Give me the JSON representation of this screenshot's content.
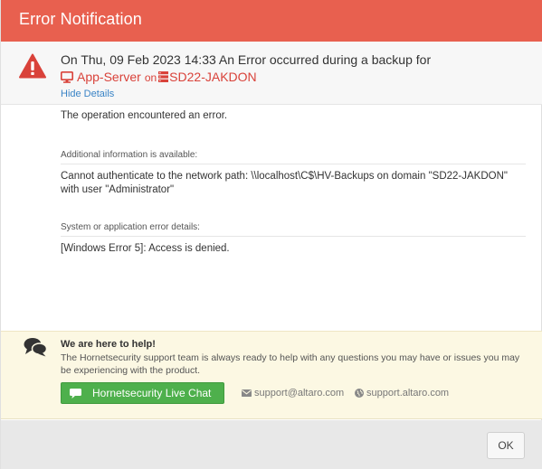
{
  "window": {
    "title": "Error Notification"
  },
  "summary": {
    "headline": "On Thu, 09 Feb 2023 14:33 An Error occurred during a backup for",
    "vm_name": "App-Server",
    "on_text": "on",
    "host_name": "SD22-JAKDON",
    "hide_details": "Hide Details",
    "icons": [
      "warning-icon",
      "monitor-icon",
      "server-icon"
    ]
  },
  "details": {
    "message": "The operation encountered an error.",
    "additional_label": "Additional information is available:",
    "additional_text": "Cannot authenticate to the network path: \\\\localhost\\C$\\HV-Backups on domain \"SD22-JAKDON\" with user \"Administrator\"",
    "system_label": "System or application error details:",
    "system_text": "[Windows Error 5]: Access is denied."
  },
  "help": {
    "title": "We are here to help!",
    "body": "The Hornetsecurity support team is always ready to help with any questions you may have or issues you may be experiencing with the product.",
    "chat_label": "Hornetsecurity Live Chat",
    "email": "support@altaro.com",
    "website": "support.altaro.com",
    "icons": [
      "chat-bubbles-icon",
      "comment-icon",
      "envelope-icon",
      "globe-icon"
    ]
  },
  "footer": {
    "ok_label": "OK"
  },
  "colors": {
    "title_bar": "#e8604f",
    "error_red": "#d9423a",
    "link_blue": "#3a84c6",
    "help_bg": "#fcf8e3",
    "chat_green": "#4eb04c",
    "footer_bg": "#e8e8e8"
  }
}
